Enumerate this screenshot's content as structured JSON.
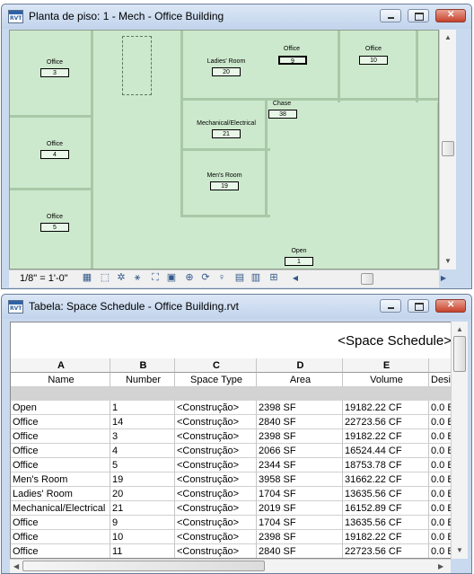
{
  "window1": {
    "title": "Planta de piso: 1 - Mech - Office Building",
    "rooms": [
      {
        "name": "Office",
        "number": "3"
      },
      {
        "name": "Office",
        "number": "4"
      },
      {
        "name": "Office",
        "number": "5"
      },
      {
        "name": "Ladies' Room",
        "number": "20"
      },
      {
        "name": "Mechanical/Electrical",
        "number": "21"
      },
      {
        "name": "Men's Room",
        "number": "19"
      },
      {
        "name": "Chase",
        "number": "38"
      },
      {
        "name": "Office",
        "number": "9"
      },
      {
        "name": "Office",
        "number": "10"
      },
      {
        "name": "Open",
        "number": "1"
      }
    ],
    "scale": "1/8\" = 1'-0\""
  },
  "window2": {
    "title": "Tabela: Space Schedule - Office Building.rvt",
    "schedule_title": "<Space Schedule>",
    "column_letters": [
      "A",
      "B",
      "C",
      "D",
      "E",
      ""
    ],
    "column_headers": [
      "Name",
      "Number",
      "Space Type",
      "Area",
      "Volume",
      "Desi"
    ],
    "rows": [
      [
        "Open",
        "1",
        "<Construção>",
        "2398 SF",
        "19182.22 CF",
        "0.0 B"
      ],
      [
        "Office",
        "14",
        "<Construção>",
        "2840 SF",
        "22723.56 CF",
        "0.0 B"
      ],
      [
        "Office",
        "3",
        "<Construção>",
        "2398 SF",
        "19182.22 CF",
        "0.0 B"
      ],
      [
        "Office",
        "4",
        "<Construção>",
        "2066 SF",
        "16524.44 CF",
        "0.0 B"
      ],
      [
        "Office",
        "5",
        "<Construção>",
        "2344 SF",
        "18753.78 CF",
        "0.0 B"
      ],
      [
        "Men's Room",
        "19",
        "<Construção>",
        "3958 SF",
        "31662.22 CF",
        "0.0 B"
      ],
      [
        "Ladies' Room",
        "20",
        "<Construção>",
        "1704 SF",
        "13635.56 CF",
        "0.0 B"
      ],
      [
        "Mechanical/Electrical",
        "21",
        "<Construção>",
        "2019 SF",
        "16152.89 CF",
        "0.0 B"
      ],
      [
        "Office",
        "9",
        "<Construção>",
        "1704 SF",
        "13635.56 CF",
        "0.0 B"
      ],
      [
        "Office",
        "10",
        "<Construção>",
        "2398 SF",
        "19182.22 CF",
        "0.0 B"
      ],
      [
        "Office",
        "11",
        "<Construção>",
        "2840 SF",
        "22723.56 CF",
        "0.0 B"
      ]
    ]
  },
  "colors": {
    "plan_fill": "#cde9cd",
    "titlebar": "#c9d9ee",
    "close_button": "#c7422b"
  }
}
